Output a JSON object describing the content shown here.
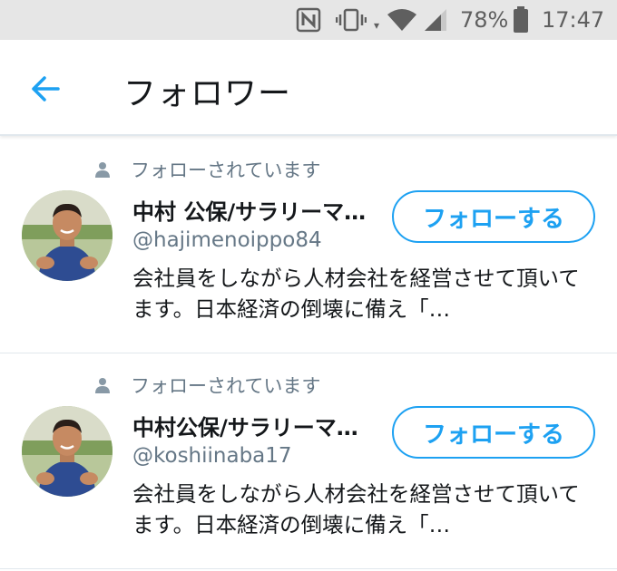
{
  "status_bar": {
    "battery_percent": "78%",
    "time": "17:47",
    "icons": [
      "nfc-icon",
      "vibrate-icon",
      "data-arrow-icon",
      "wifi-icon",
      "cell-signal-icon",
      "battery-icon"
    ]
  },
  "header": {
    "back_icon": "arrow-left-icon",
    "title": "フォロワー"
  },
  "colors": {
    "accent": "#1da1f2",
    "secondary_text": "#657786",
    "primary_text": "#14171a",
    "status_bar_bg": "#e6e6e6"
  },
  "followers": [
    {
      "follows_you": "フォローされています",
      "display_name": "中村 公保/サラリーマン…",
      "handle": "@hajimenoippo84",
      "bio": "会社員をしながら人材会社を経営させて頂いてます。日本経済の倒壊に備え「…",
      "follow_label": "フォローする"
    },
    {
      "follows_you": "フォローされています",
      "display_name": "中村公保/サラリーマ…",
      "handle": "@koshiinaba17",
      "bio": "会社員をしながら人材会社を経営させて頂いてます。日本経済の倒壊に備え「…",
      "follow_label": "フォローする"
    }
  ]
}
